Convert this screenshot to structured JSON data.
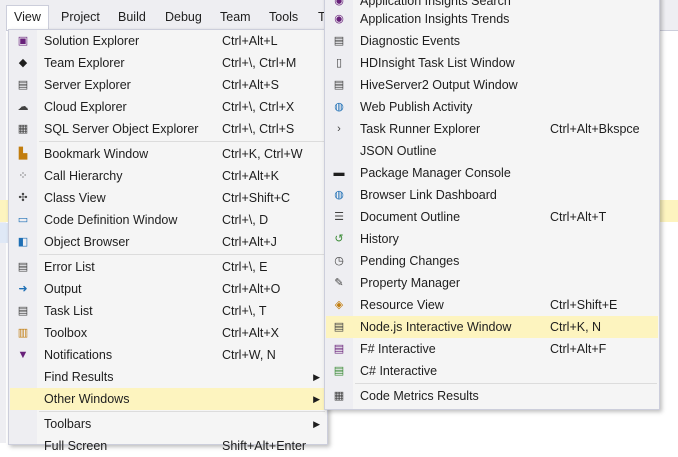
{
  "menubar": {
    "items": [
      {
        "label": "View"
      },
      {
        "label": "Project"
      },
      {
        "label": "Build"
      },
      {
        "label": "Debug"
      },
      {
        "label": "Team"
      },
      {
        "label": "Tools"
      },
      {
        "label": "T"
      }
    ]
  },
  "view_menu": {
    "items": [
      {
        "label": "Solution Explorer",
        "shortcut": "Ctrl+Alt+L",
        "icon": "solution-explorer-icon"
      },
      {
        "label": "Team Explorer",
        "shortcut": "Ctrl+\\, Ctrl+M",
        "icon": "team-explorer-icon"
      },
      {
        "label": "Server Explorer",
        "shortcut": "Ctrl+Alt+S",
        "icon": "server-explorer-icon"
      },
      {
        "label": "Cloud Explorer",
        "shortcut": "Ctrl+\\, Ctrl+X",
        "icon": "cloud-icon"
      },
      {
        "label": "SQL Server Object Explorer",
        "shortcut": "Ctrl+\\, Ctrl+S",
        "icon": "sql-server-icon"
      },
      {
        "label": "Bookmark Window",
        "shortcut": "Ctrl+K, Ctrl+W",
        "icon": "bookmark-icon"
      },
      {
        "label": "Call Hierarchy",
        "shortcut": "Ctrl+Alt+K",
        "icon": "call-hierarchy-icon"
      },
      {
        "label": "Class View",
        "shortcut": "Ctrl+Shift+C",
        "icon": "class-view-icon"
      },
      {
        "label": "Code Definition Window",
        "shortcut": "Ctrl+\\, D",
        "icon": "code-definition-icon"
      },
      {
        "label": "Object Browser",
        "shortcut": "Ctrl+Alt+J",
        "icon": "object-browser-icon"
      },
      {
        "label": "Error List",
        "shortcut": "Ctrl+\\, E",
        "icon": "error-list-icon"
      },
      {
        "label": "Output",
        "shortcut": "Ctrl+Alt+O",
        "icon": "output-icon"
      },
      {
        "label": "Task List",
        "shortcut": "Ctrl+\\, T",
        "icon": "task-list-icon"
      },
      {
        "label": "Toolbox",
        "shortcut": "Ctrl+Alt+X",
        "icon": "toolbox-icon"
      },
      {
        "label": "Notifications",
        "shortcut": "Ctrl+W, N",
        "icon": "notifications-icon"
      },
      {
        "label": "Find Results",
        "shortcut": ""
      },
      {
        "label": "Other Windows",
        "shortcut": ""
      },
      {
        "label": "Toolbars",
        "shortcut": ""
      },
      {
        "label": "Full Screen",
        "shortcut": "Shift+Alt+Enter"
      }
    ]
  },
  "other_windows_menu": {
    "items": [
      {
        "label": "Application Insights Search",
        "shortcut": "",
        "icon": "app-insights-search-icon"
      },
      {
        "label": "Application Insights Trends",
        "shortcut": "",
        "icon": "app-insights-trends-icon"
      },
      {
        "label": "Diagnostic Events",
        "shortcut": "",
        "icon": "diagnostic-events-icon"
      },
      {
        "label": "HDInsight Task List Window",
        "shortcut": "",
        "icon": "hdinsight-icon"
      },
      {
        "label": "HiveServer2 Output Window",
        "shortcut": "",
        "icon": "hiveserver-icon"
      },
      {
        "label": "Web Publish Activity",
        "shortcut": "",
        "icon": "web-publish-icon"
      },
      {
        "label": "Task Runner Explorer",
        "shortcut": "Ctrl+Alt+Bkspce",
        "icon": "task-runner-icon"
      },
      {
        "label": "JSON Outline",
        "shortcut": "",
        "icon": ""
      },
      {
        "label": "Package Manager Console",
        "shortcut": "",
        "icon": "console-icon"
      },
      {
        "label": "Browser Link Dashboard",
        "shortcut": "",
        "icon": "browser-link-icon"
      },
      {
        "label": "Document Outline",
        "shortcut": "Ctrl+Alt+T",
        "icon": "document-outline-icon"
      },
      {
        "label": "History",
        "shortcut": "",
        "icon": "history-icon"
      },
      {
        "label": "Pending Changes",
        "shortcut": "",
        "icon": "pending-changes-icon"
      },
      {
        "label": "Property Manager",
        "shortcut": "",
        "icon": "property-manager-icon"
      },
      {
        "label": "Resource View",
        "shortcut": "Ctrl+Shift+E",
        "icon": "resource-view-icon"
      },
      {
        "label": "Node.js Interactive Window",
        "shortcut": "Ctrl+K, N",
        "icon": "nodejs-icon"
      },
      {
        "label": "F# Interactive",
        "shortcut": "Ctrl+Alt+F",
        "icon": "fsharp-icon"
      },
      {
        "label": "C# Interactive",
        "shortcut": "",
        "icon": "csharp-icon"
      },
      {
        "label": "Code Metrics Results",
        "shortcut": "",
        "icon": "code-metrics-icon"
      }
    ]
  },
  "colors": {
    "highlight": "#fdf4bf",
    "menu_bg": "#f5f5f5",
    "gutter": "#eeeef2",
    "vs_purple": "#68217a"
  }
}
